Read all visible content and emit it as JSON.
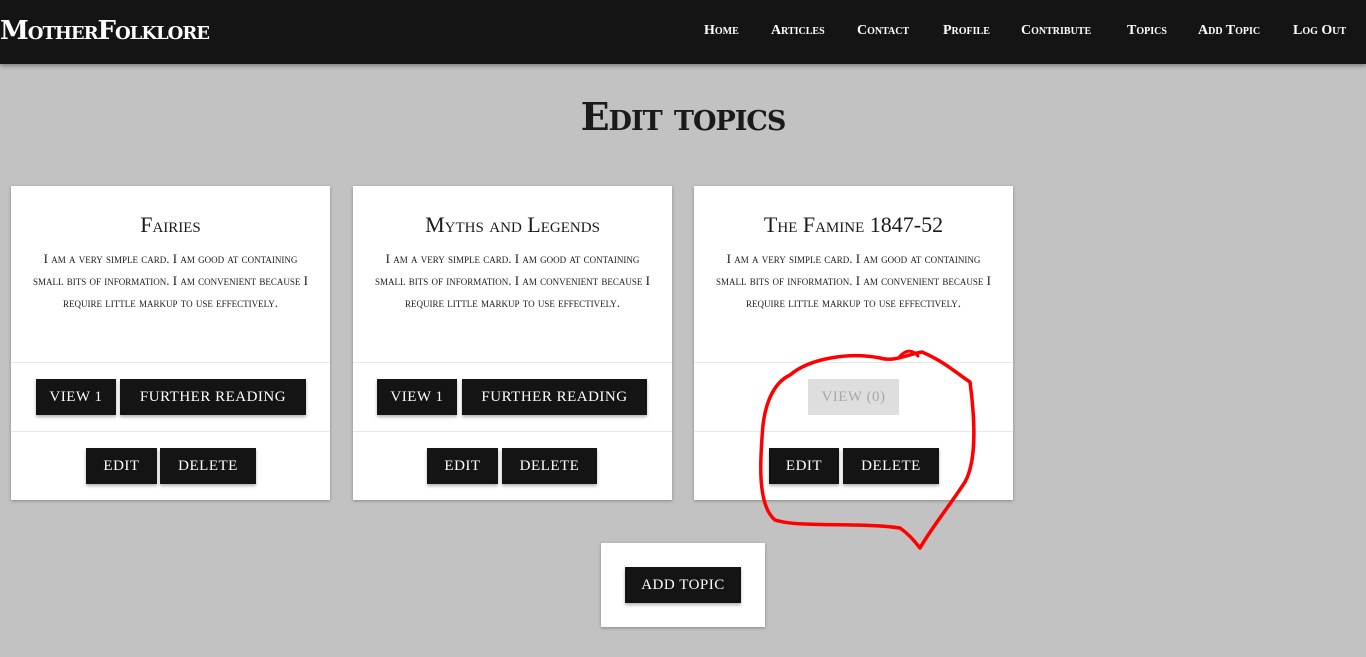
{
  "nav": {
    "brand": "MotherFolklore",
    "links": [
      "Home",
      "Articles",
      "Contact",
      "Profile",
      "Contribute",
      "Topics",
      "Add Topic",
      "Log Out"
    ]
  },
  "page": {
    "title": "Edit topics"
  },
  "cards": [
    {
      "title": "Fairies",
      "text": "I am a very simple card. I am good at containing small bits of information. I am convenient because I require little markup to use effectively.",
      "view_label": "VIEW 1",
      "further_label": "FURTHER READING",
      "edit_label": "EDIT",
      "delete_label": "DELETE"
    },
    {
      "title": "Myths and Legends",
      "text": "I am a very simple card. I am good at containing small bits of information. I am convenient because I require little markup to use effectively.",
      "view_label": "VIEW 1",
      "further_label": "FURTHER READING",
      "edit_label": "EDIT",
      "delete_label": "DELETE"
    },
    {
      "title": "The Famine 1847-52",
      "text": "I am a very simple card. I am good at containing small bits of information. I am convenient because I require little markup to use effectively.",
      "view_label": "VIEW (0)",
      "edit_label": "EDIT",
      "delete_label": "DELETE"
    }
  ],
  "add_topic_label": "ADD TOPIC",
  "colors": {
    "navbar": "#141414",
    "page_background": "#c1c2c1",
    "button": "#141414",
    "disabled_button": "#dedede",
    "annotation": "#ff0000"
  }
}
